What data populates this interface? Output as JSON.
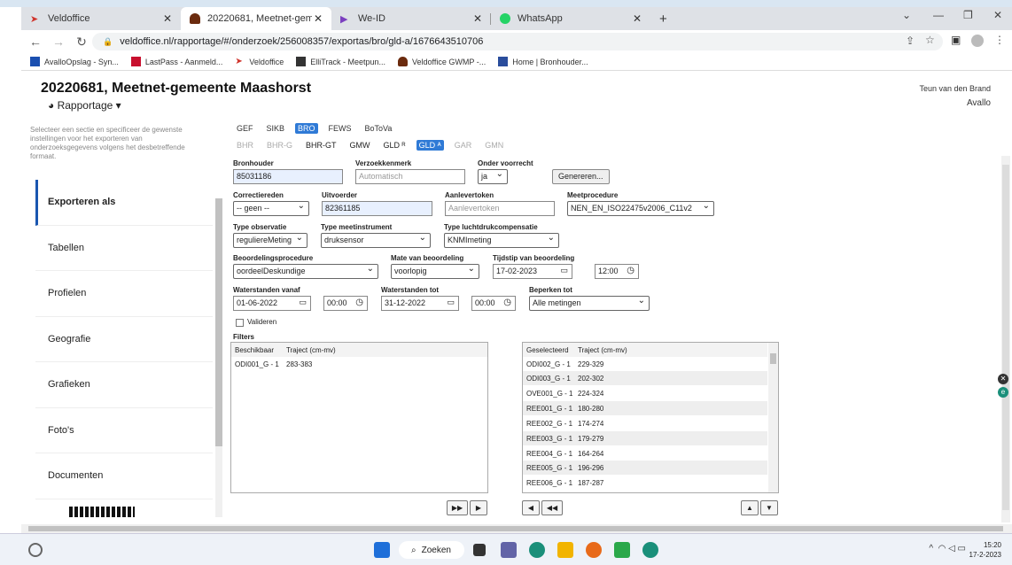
{
  "browser": {
    "tabs": [
      {
        "label": "Veldoffice",
        "active": false
      },
      {
        "label": "20220681, Meetnet-gemeente M",
        "active": true
      },
      {
        "label": "We-ID",
        "active": false
      },
      {
        "label": "WhatsApp",
        "active": false
      }
    ],
    "new_tab": "+",
    "url": "veldoffice.nl/rapportage/#/onderzoek/256008357/exportas/bro/gld-a/1676643510706",
    "bookmarks": [
      {
        "label": "AvalloOpslag - Syn...",
        "color": "#1a4fb0"
      },
      {
        "label": "LastPass - Aanmeld...",
        "color": "#c8102e"
      },
      {
        "label": "Veldoffice",
        "color": "#d0342c"
      },
      {
        "label": "ElliTrack - Meetpun...",
        "color": "#333333"
      },
      {
        "label": "Veldoffice GWMP -...",
        "color": "#6b2b0e"
      },
      {
        "label": "Home | Bronhouder...",
        "color": "#2a4d9c"
      }
    ]
  },
  "header": {
    "title": "20220681, Meetnet-gemeente Maashorst",
    "menu": "Rapportage",
    "user": "Teun van den Brand",
    "org": "Avallo"
  },
  "sidebar": {
    "help": "Selecteer een sectie en specificeer de gewenste instellingen voor het exporteren van onderzoeksgegevens volgens het desbetreffende formaat.",
    "items": [
      "Exporteren als",
      "Tabellen",
      "Profielen",
      "Geografie",
      "Grafieken",
      "Foto's",
      "Documenten"
    ]
  },
  "formats": [
    "GEF",
    "SIKB",
    "BRO",
    "FEWS",
    "BoToVa"
  ],
  "subformats": [
    {
      "label": "BHR",
      "state": "off"
    },
    {
      "label": "BHR-G",
      "state": "off"
    },
    {
      "label": "BHR-GT",
      "state": "on"
    },
    {
      "label": "GMW",
      "state": "on"
    },
    {
      "label": "GLD ᴿ",
      "state": "on"
    },
    {
      "label": "GLD ᴬ",
      "state": "sel"
    },
    {
      "label": "GAR",
      "state": "off"
    },
    {
      "label": "GMN",
      "state": "off"
    }
  ],
  "form": {
    "bronhouder_label": "Bronhouder",
    "bronhouder": "85031186",
    "verzoekkenmerk_label": "Verzoekkenmerk",
    "verzoekkenmerk_ph": "Automatisch",
    "onder_voorrecht_label": "Onder voorrecht",
    "onder_voorrecht": "ja",
    "genereren": "Genereren...",
    "correctiereden_label": "Correctiereden",
    "correctiereden": "-- geen --",
    "uitvoerder_label": "Uitvoerder",
    "uitvoerder": "82361185",
    "aanlevertoken_label": "Aanlevertoken",
    "aanlevertoken_ph": "Aanlevertoken",
    "meetprocedure_label": "Meetprocedure",
    "meetprocedure": "NEN_EN_ISO22475v2006_C11v2",
    "type_observatie_label": "Type observatie",
    "type_observatie": "reguliereMeting",
    "type_meetinstrument_label": "Type meetinstrument",
    "type_meetinstrument": "druksensor",
    "type_lucht_label": "Type luchtdrukcompensatie",
    "type_lucht": "KNMImeting",
    "beoordelingsprocedure_label": "Beoordelingsprocedure",
    "beoordelingsprocedure": "oordeelDeskundige",
    "mate_label": "Mate van beoordeling",
    "mate": "voorlopig",
    "tijdstip_label": "Tijdstip van beoordeling",
    "tijdstip_date": "17-02-2023",
    "tijdstip_time": "12:00",
    "vanaf_label": "Waterstanden vanaf",
    "vanaf_date": "01-06-2022",
    "vanaf_time": "00:00",
    "tot_label": "Waterstanden tot",
    "tot_date": "31-12-2022",
    "tot_time": "00:00",
    "beperken_label": "Beperken tot",
    "beperken": "Alle metingen",
    "valideren": "Valideren",
    "filters_label": "Filters"
  },
  "filters": {
    "available_headers": [
      "Beschikbaar",
      "Traject (cm-mv)"
    ],
    "available": [
      [
        "ODI001_G - 1",
        "283-383"
      ]
    ],
    "selected_headers": [
      "Geselecteerd",
      "Traject (cm-mv)"
    ],
    "selected": [
      [
        "ODI002_G - 1",
        "229-329"
      ],
      [
        "ODI003_G - 1",
        "202-302"
      ],
      [
        "OVE001_G - 1",
        "224-324"
      ],
      [
        "REE001_G - 1",
        "180-280"
      ],
      [
        "REE002_G - 1",
        "174-274"
      ],
      [
        "REE003_G - 1",
        "179-279"
      ],
      [
        "REE004_G - 1",
        "164-264"
      ],
      [
        "REE005_G - 1",
        "196-296"
      ],
      [
        "REE006_G - 1",
        "187-287"
      ]
    ],
    "buttons": {
      "add_all": "▶▶",
      "add": "▶",
      "remove": "◀",
      "remove_all": "◀◀",
      "up": "▲",
      "down": "▼"
    }
  },
  "taskbar": {
    "search": "Zoeken",
    "time": "15:20",
    "date": "17-2-2023"
  }
}
